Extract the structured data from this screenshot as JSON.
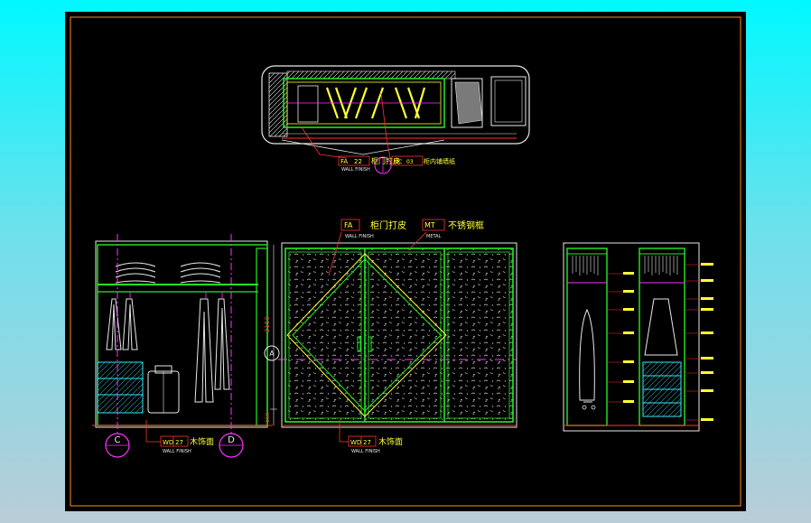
{
  "drawing": {
    "background": "#000000",
    "frame_color": "#ff8a1e",
    "colors": {
      "white": "#e8e8e8",
      "green": "#22ee22",
      "yellow": "#ffff33",
      "red": "#ff3333",
      "magenta": "#ff33ff",
      "cyan": "#33e8ff",
      "blue": "#4a5cff"
    }
  },
  "plan": {
    "callout_1": {
      "code": "FA",
      "num": "22",
      "text": "柜门打皮",
      "sub": "WALL FINISH"
    },
    "callout_2": {
      "code": "MC",
      "num": "03",
      "text": "柜内铺墙纸"
    }
  },
  "front_elevation": {
    "callout_fa": {
      "code": "FA",
      "num": "",
      "text": "柜门打皮",
      "sub": "WALL FINISH"
    },
    "callout_mt": {
      "code": "MT",
      "num": "",
      "text": "不锈钢框",
      "sub": "METAL"
    },
    "callout_wd": {
      "code": "WD",
      "num": "27",
      "text": "木饰面",
      "sub": "WALL FINISH"
    },
    "dim_upper": "2150",
    "dim_lower": "150",
    "section_marker": "A"
  },
  "side_elevation": {
    "callout_wd": {
      "code": "WD",
      "num": "27",
      "text": "木饰面",
      "sub": "WALL FINISH"
    },
    "marker_left": "C",
    "marker_right": "D"
  }
}
